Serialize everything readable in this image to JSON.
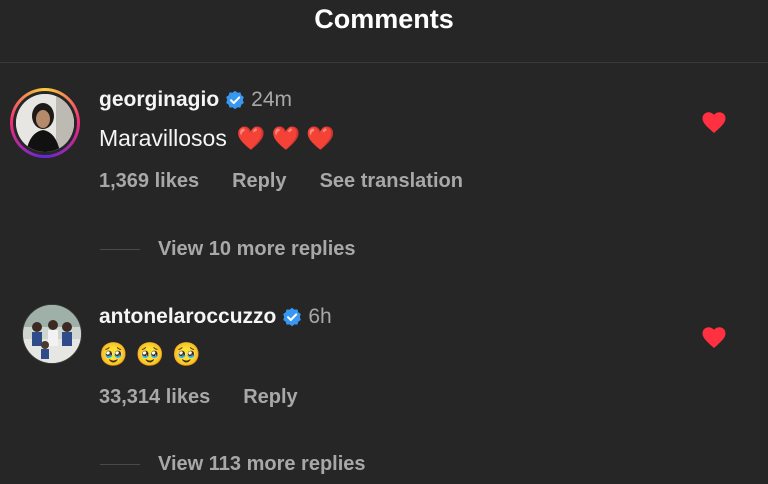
{
  "header": {
    "title": "Comments"
  },
  "comments": [
    {
      "username": "georginagio",
      "verified": true,
      "time": "24m",
      "text": "Maravillosos",
      "emojis": [
        "❤️",
        "❤️",
        "❤️"
      ],
      "likes": "1,369 likes",
      "reply_label": "Reply",
      "translate_label": "See translation",
      "liked": true,
      "view_replies": "View 10 more replies"
    },
    {
      "username": "antonelaroccuzzo",
      "verified": true,
      "time": "6h",
      "text": "",
      "emojis": [
        "🥹",
        "🥹",
        "🥹"
      ],
      "likes": "33,314 likes",
      "reply_label": "Reply",
      "liked": true,
      "view_replies": "View 113 more replies"
    }
  ],
  "colors": {
    "background": "#262626",
    "secondary_text": "#a8a8a8",
    "verified_blue": "#3897f0",
    "like_red": "#ff3040"
  }
}
